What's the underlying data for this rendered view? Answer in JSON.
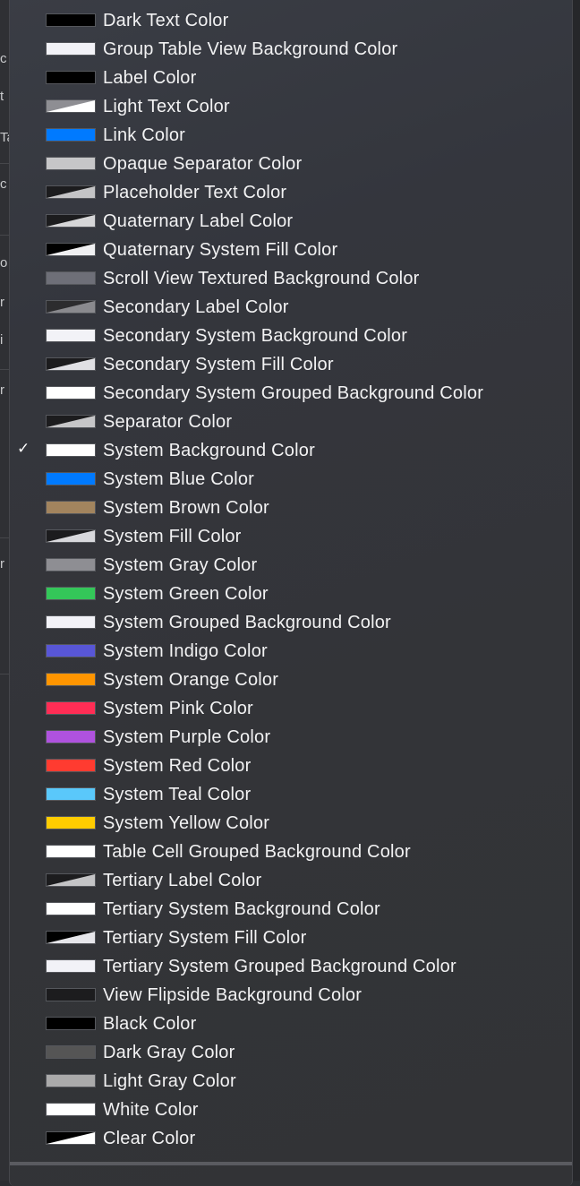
{
  "background_fragments": [
    "c",
    "t",
    "Ta",
    "c",
    "o",
    "r",
    "i",
    "r",
    "r"
  ],
  "menu": {
    "items": [
      {
        "label": "Dark Text Color",
        "swatch": "solid",
        "color": "#000000",
        "checked": false
      },
      {
        "label": "Group Table View Background Color",
        "swatch": "solid",
        "color": "#f2f2f7",
        "checked": false
      },
      {
        "label": "Label Color",
        "swatch": "solid",
        "color": "#000000",
        "checked": false
      },
      {
        "label": "Light Text Color",
        "swatch": "diag",
        "color": "#8e8e93",
        "color2": "#ffffff",
        "checked": false
      },
      {
        "label": "Link Color",
        "swatch": "solid",
        "color": "#007aff",
        "checked": false
      },
      {
        "label": "Opaque Separator Color",
        "swatch": "solid",
        "color": "#c6c6c8",
        "checked": false
      },
      {
        "label": "Placeholder Text Color",
        "swatch": "diag",
        "color": "#1c1c1e",
        "color2": "#c4c4c6",
        "checked": false
      },
      {
        "label": "Quaternary Label Color",
        "swatch": "diag",
        "color": "#1c1c1e",
        "color2": "#d6d6d8",
        "checked": false
      },
      {
        "label": "Quaternary System Fill Color",
        "swatch": "diag",
        "color": "#000000",
        "color2": "#f0f0f2",
        "checked": false
      },
      {
        "label": "Scroll View Textured Background Color",
        "swatch": "solid",
        "color": "#6e6f78",
        "checked": false
      },
      {
        "label": "Secondary Label Color",
        "swatch": "diag",
        "color": "#2c2c2e",
        "color2": "#8a8a8e",
        "checked": false
      },
      {
        "label": "Secondary System Background Color",
        "swatch": "solid",
        "color": "#f2f2f7",
        "checked": false
      },
      {
        "label": "Secondary System Fill Color",
        "swatch": "diag",
        "color": "#1c1c1e",
        "color2": "#e0e0e4",
        "checked": false
      },
      {
        "label": "Secondary System Grouped Background Color",
        "swatch": "solid",
        "color": "#ffffff",
        "checked": false
      },
      {
        "label": "Separator Color",
        "swatch": "diag",
        "color": "#1c1c1e",
        "color2": "#c6c6c8",
        "checked": false
      },
      {
        "label": "System Background Color",
        "swatch": "solid",
        "color": "#ffffff",
        "checked": true
      },
      {
        "label": "System Blue Color",
        "swatch": "solid",
        "color": "#007aff",
        "checked": false
      },
      {
        "label": "System Brown Color",
        "swatch": "solid",
        "color": "#a2845e",
        "checked": false
      },
      {
        "label": "System Fill Color",
        "swatch": "diag",
        "color": "#1c1c1e",
        "color2": "#d8d8dc",
        "checked": false
      },
      {
        "label": "System Gray Color",
        "swatch": "solid",
        "color": "#8e8e93",
        "checked": false
      },
      {
        "label": "System Green Color",
        "swatch": "solid",
        "color": "#34c759",
        "checked": false
      },
      {
        "label": "System Grouped Background Color",
        "swatch": "solid",
        "color": "#f2f2f7",
        "checked": false
      },
      {
        "label": "System Indigo Color",
        "swatch": "solid",
        "color": "#5856d6",
        "checked": false
      },
      {
        "label": "System Orange Color",
        "swatch": "solid",
        "color": "#ff9500",
        "checked": false
      },
      {
        "label": "System Pink Color",
        "swatch": "solid",
        "color": "#ff2d55",
        "checked": false
      },
      {
        "label": "System Purple Color",
        "swatch": "solid",
        "color": "#af52de",
        "checked": false
      },
      {
        "label": "System Red Color",
        "swatch": "solid",
        "color": "#ff3b30",
        "checked": false
      },
      {
        "label": "System Teal Color",
        "swatch": "solid",
        "color": "#5ac8fa",
        "checked": false
      },
      {
        "label": "System Yellow Color",
        "swatch": "solid",
        "color": "#ffcc00",
        "checked": false
      },
      {
        "label": "Table Cell Grouped Background Color",
        "swatch": "solid",
        "color": "#ffffff",
        "checked": false
      },
      {
        "label": "Tertiary Label Color",
        "swatch": "diag",
        "color": "#1c1c1e",
        "color2": "#c4c4c6",
        "checked": false
      },
      {
        "label": "Tertiary System Background Color",
        "swatch": "solid",
        "color": "#ffffff",
        "checked": false
      },
      {
        "label": "Tertiary System Fill Color",
        "swatch": "diag",
        "color": "#000000",
        "color2": "#e6e6ea",
        "checked": false
      },
      {
        "label": "Tertiary System Grouped Background Color",
        "swatch": "solid",
        "color": "#f2f2f7",
        "checked": false
      },
      {
        "label": "View Flipside Background Color",
        "swatch": "solid",
        "color": "#1c1c1e",
        "checked": false
      },
      {
        "label": "Black Color",
        "swatch": "solid",
        "color": "#000000",
        "checked": false
      },
      {
        "label": "Dark Gray Color",
        "swatch": "solid",
        "color": "#555555",
        "checked": false
      },
      {
        "label": "Light Gray Color",
        "swatch": "solid",
        "color": "#aaaaaa",
        "checked": false
      },
      {
        "label": "White Color",
        "swatch": "solid",
        "color": "#ffffff",
        "checked": false
      },
      {
        "label": "Clear Color",
        "swatch": "diag",
        "color": "#000000",
        "color2": "#ffffff",
        "checked": false
      }
    ]
  }
}
